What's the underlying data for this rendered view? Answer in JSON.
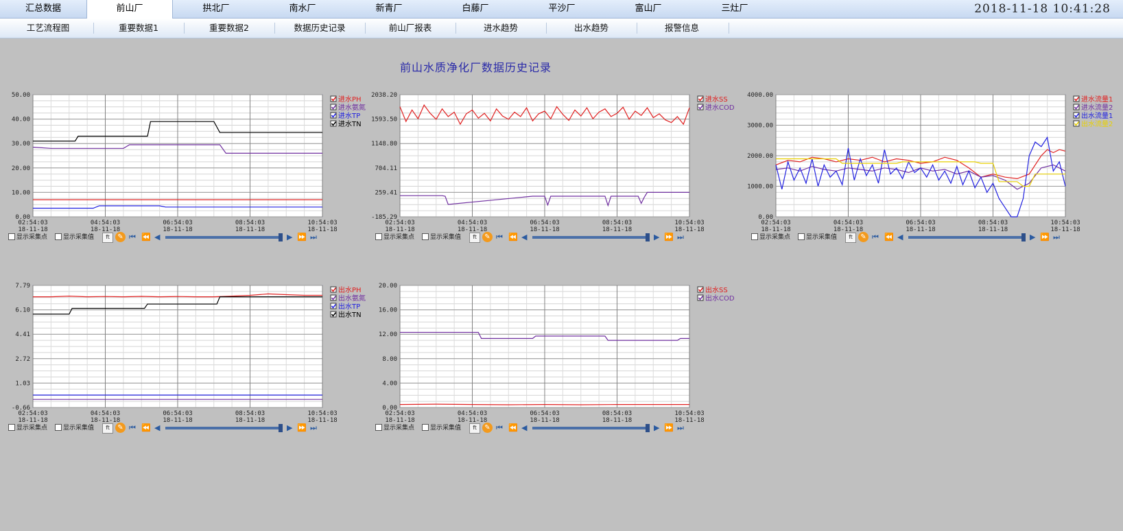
{
  "tabs": [
    {
      "label": "汇总数据"
    },
    {
      "label": "前山厂"
    },
    {
      "label": "拱北厂"
    },
    {
      "label": "南水厂"
    },
    {
      "label": "新青厂"
    },
    {
      "label": "白藤厂"
    },
    {
      "label": "平沙厂"
    },
    {
      "label": "富山厂"
    },
    {
      "label": "三灶厂"
    }
  ],
  "active_tab": "前山厂",
  "clock": "2018-11-18  10:41:28",
  "subtabs": [
    {
      "label": "工艺流程图"
    },
    {
      "label": "重要数据1"
    },
    {
      "label": "重要数据2"
    },
    {
      "label": "数据历史记录"
    },
    {
      "label": "前山厂报表"
    },
    {
      "label": "进水趋势"
    },
    {
      "label": "出水趋势"
    },
    {
      "label": "报警信息"
    }
  ],
  "page_title": "前山水质净化厂数据历史记录",
  "controls": {
    "show_points": "显示采集点",
    "show_values": "显示采集值",
    "icon_a": "ft",
    "icon_b": "✎"
  },
  "colors": {
    "red": "#e02020",
    "purple": "#7030a0",
    "blue": "#2020e0",
    "black": "#000000",
    "yellow": "#e8d000",
    "grid": "#9a9a9a",
    "frame": "#8080c8"
  },
  "chart_data": [
    {
      "type": "line",
      "x_labels": [
        [
          "02:54:03",
          "18-11-18"
        ],
        [
          "04:54:03",
          "18-11-18"
        ],
        [
          "06:54:03",
          "18-11-18"
        ],
        [
          "08:54:03",
          "18-11-18"
        ],
        [
          "10:54:03",
          "18-11-18"
        ]
      ],
      "y_ticks": [
        "50.00",
        "40.00",
        "30.00",
        "20.00",
        "10.00",
        "0.00"
      ],
      "ylim": [
        0,
        50
      ],
      "x_range": [
        0,
        480
      ],
      "series": [
        {
          "name": "进水PH",
          "color": "#e02020",
          "x": [
            0,
            480
          ],
          "y": [
            7.0,
            7.0
          ]
        },
        {
          "name": "进水氨氮",
          "color": "#7030a0",
          "x": [
            0,
            30,
            150,
            160,
            310,
            320,
            480
          ],
          "y": [
            28.5,
            28.0,
            28.0,
            29.5,
            29.5,
            26.0,
            26.0
          ]
        },
        {
          "name": "进水TP",
          "color": "#2020e0",
          "x": [
            0,
            100,
            110,
            210,
            220,
            480
          ],
          "y": [
            3.5,
            3.5,
            4.5,
            4.5,
            4.0,
            4.0
          ]
        },
        {
          "name": "进水TN",
          "color": "#000000",
          "x": [
            0,
            70,
            75,
            190,
            195,
            300,
            310,
            480
          ],
          "y": [
            31.0,
            31.0,
            33.0,
            33.0,
            39.0,
            39.0,
            34.5,
            34.5
          ]
        }
      ]
    },
    {
      "type": "line",
      "x_labels": [
        [
          "02:54:03",
          "18-11-18"
        ],
        [
          "04:54:03",
          "18-11-18"
        ],
        [
          "06:54:03",
          "18-11-18"
        ],
        [
          "08:54:03",
          "18-11-18"
        ],
        [
          "10:54:03",
          "18-11-18"
        ]
      ],
      "y_ticks": [
        "2038.20",
        "1593.50",
        "1148.80",
        "704.11",
        "259.41",
        "-185.29"
      ],
      "ylim": [
        -185.29,
        2038.2
      ],
      "x_range": [
        0,
        480
      ],
      "series": [
        {
          "name": "进水SS",
          "color": "#e02020",
          "x": [
            0,
            10,
            20,
            30,
            40,
            50,
            60,
            70,
            80,
            90,
            100,
            110,
            120,
            130,
            140,
            150,
            160,
            170,
            180,
            190,
            200,
            210,
            220,
            230,
            240,
            250,
            260,
            270,
            280,
            290,
            300,
            310,
            320,
            330,
            340,
            350,
            360,
            370,
            380,
            390,
            400,
            410,
            420,
            430,
            440,
            450,
            460,
            470,
            480
          ],
          "y": [
            1820,
            1550,
            1760,
            1600,
            1850,
            1700,
            1590,
            1780,
            1640,
            1720,
            1500,
            1690,
            1760,
            1610,
            1700,
            1560,
            1780,
            1650,
            1590,
            1720,
            1640,
            1800,
            1560,
            1690,
            1740,
            1600,
            1820,
            1680,
            1570,
            1760,
            1650,
            1800,
            1600,
            1720,
            1780,
            1640,
            1700,
            1810,
            1590,
            1740,
            1660,
            1800,
            1620,
            1690,
            1580,
            1530,
            1640,
            1500,
            1800
          ]
        },
        {
          "name": "进水COD",
          "color": "#7030a0",
          "x": [
            0,
            70,
            75,
            80,
            220,
            240,
            245,
            250,
            340,
            345,
            350,
            395,
            400,
            405,
            410,
            480
          ],
          "y": [
            200,
            200,
            190,
            40,
            190,
            190,
            30,
            190,
            190,
            20,
            190,
            190,
            60,
            170,
            260,
            260
          ]
        }
      ]
    },
    {
      "type": "line",
      "x_labels": [
        [
          "02:54:03",
          "18-11-18"
        ],
        [
          "04:54:03",
          "18-11-18"
        ],
        [
          "06:54:03",
          "18-11-18"
        ],
        [
          "08:54:03",
          "18-11-18"
        ],
        [
          "10:54:03",
          "18-11-18"
        ]
      ],
      "y_ticks": [
        "4000.00",
        "3000.00",
        "2000.00",
        "1000.00",
        "0.00"
      ],
      "ylim": [
        0,
        4000
      ],
      "x_range": [
        0,
        480
      ],
      "series": [
        {
          "name": "进水流量1",
          "color": "#e02020",
          "x": [
            0,
            20,
            40,
            60,
            80,
            100,
            120,
            140,
            160,
            180,
            200,
            220,
            240,
            260,
            280,
            300,
            320,
            340,
            360,
            380,
            400,
            420,
            440,
            450,
            460,
            470,
            480
          ],
          "y": [
            1700,
            1850,
            1800,
            1950,
            1900,
            1800,
            1900,
            1850,
            1950,
            1800,
            1900,
            1850,
            1750,
            1800,
            1950,
            1850,
            1600,
            1300,
            1400,
            1300,
            1250,
            1400,
            2000,
            2200,
            2100,
            2200,
            2150
          ]
        },
        {
          "name": "进水流量2",
          "color": "#7030a0",
          "x": [
            0,
            20,
            40,
            60,
            80,
            100,
            120,
            140,
            160,
            180,
            200,
            220,
            240,
            260,
            280,
            300,
            320,
            340,
            360,
            380,
            400,
            420,
            440,
            460,
            480
          ],
          "y": [
            1550,
            1600,
            1500,
            1650,
            1550,
            1500,
            1600,
            1550,
            1500,
            1600,
            1550,
            1450,
            1600,
            1500,
            1550,
            1400,
            1500,
            1300,
            1350,
            1200,
            900,
            1100,
            1600,
            1700,
            1500
          ]
        },
        {
          "name": "出水流量1",
          "color": "#2020e0",
          "x": [
            0,
            10,
            20,
            30,
            40,
            50,
            60,
            70,
            80,
            90,
            100,
            110,
            120,
            130,
            140,
            150,
            160,
            170,
            180,
            190,
            200,
            210,
            220,
            230,
            240,
            250,
            260,
            270,
            280,
            290,
            300,
            310,
            320,
            330,
            340,
            350,
            360,
            370,
            380,
            390,
            400,
            410,
            420,
            430,
            440,
            450,
            460,
            470,
            480
          ],
          "y": [
            1700,
            900,
            1800,
            1200,
            1600,
            1100,
            1900,
            1000,
            1700,
            1300,
            1500,
            1050,
            2250,
            1200,
            1900,
            1350,
            1700,
            1100,
            2200,
            1400,
            1600,
            1250,
            1800,
            1450,
            1600,
            1300,
            1700,
            1200,
            1500,
            1100,
            1650,
            1050,
            1500,
            950,
            1300,
            800,
            1100,
            600,
            300,
            0,
            0,
            600,
            2000,
            2450,
            2300,
            2600,
            1500,
            1800,
            1000
          ]
        },
        {
          "name": "出水流量2",
          "color": "#e8d000",
          "x": [
            0,
            100,
            110,
            200,
            210,
            300,
            310,
            330,
            340,
            360,
            370,
            400,
            410,
            420,
            430,
            480
          ],
          "y": [
            1900,
            1900,
            1750,
            1750,
            1800,
            1800,
            1800,
            1800,
            1750,
            1750,
            1150,
            1150,
            1000,
            1000,
            1400,
            1400
          ]
        }
      ]
    },
    {
      "type": "line",
      "x_labels": [
        [
          "02:54:03",
          "18-11-18"
        ],
        [
          "04:54:03",
          "18-11-18"
        ],
        [
          "06:54:03",
          "18-11-18"
        ],
        [
          "08:54:03",
          "18-11-18"
        ],
        [
          "10:54:03",
          "18-11-18"
        ]
      ],
      "y_ticks": [
        "7.79",
        "6.10",
        "4.41",
        "2.72",
        "1.03",
        "-0.66"
      ],
      "ylim": [
        -0.66,
        7.79
      ],
      "x_range": [
        0,
        480
      ],
      "series": [
        {
          "name": "出水PH",
          "color": "#e02020",
          "x": [
            0,
            30,
            60,
            90,
            120,
            150,
            180,
            210,
            240,
            270,
            300,
            330,
            360,
            390,
            420,
            450,
            480
          ],
          "y": [
            7.0,
            7.0,
            7.05,
            7.0,
            7.02,
            7.0,
            7.03,
            7.0,
            7.02,
            7.0,
            7.0,
            7.05,
            7.1,
            7.2,
            7.15,
            7.1,
            7.1
          ]
        },
        {
          "name": "出水氨氮",
          "color": "#7030a0",
          "x": [
            0,
            480
          ],
          "y": [
            -0.1,
            -0.1
          ]
        },
        {
          "name": "出水TP",
          "color": "#2020e0",
          "x": [
            0,
            480
          ],
          "y": [
            0.2,
            0.2
          ]
        },
        {
          "name": "出水TN",
          "color": "#000000",
          "x": [
            0,
            60,
            65,
            185,
            190,
            305,
            310,
            480
          ],
          "y": [
            5.8,
            5.8,
            6.2,
            6.2,
            6.5,
            6.5,
            7.0,
            7.0
          ]
        }
      ]
    },
    {
      "type": "line",
      "x_labels": [
        [
          "02:54:03",
          "18-11-18"
        ],
        [
          "04:54:03",
          "18-11-18"
        ],
        [
          "06:54:03",
          "18-11-18"
        ],
        [
          "08:54:03",
          "18-11-18"
        ],
        [
          "10:54:03",
          "18-11-18"
        ]
      ],
      "y_ticks": [
        "20.00",
        "16.00",
        "12.00",
        "8.00",
        "4.00",
        "0.00"
      ],
      "ylim": [
        0,
        20
      ],
      "x_range": [
        0,
        480
      ],
      "series": [
        {
          "name": "出水SS",
          "color": "#e02020",
          "x": [
            0,
            60,
            120,
            180,
            240,
            300,
            360,
            420,
            480
          ],
          "y": [
            0.5,
            0.55,
            0.5,
            0.45,
            0.5,
            0.45,
            0.5,
            0.5,
            0.5
          ]
        },
        {
          "name": "出水COD",
          "color": "#7030a0",
          "x": [
            0,
            130,
            135,
            220,
            225,
            340,
            345,
            460,
            465,
            480
          ],
          "y": [
            12.3,
            12.3,
            11.3,
            11.3,
            11.7,
            11.7,
            11.0,
            11.0,
            11.3,
            11.3
          ]
        }
      ]
    }
  ]
}
